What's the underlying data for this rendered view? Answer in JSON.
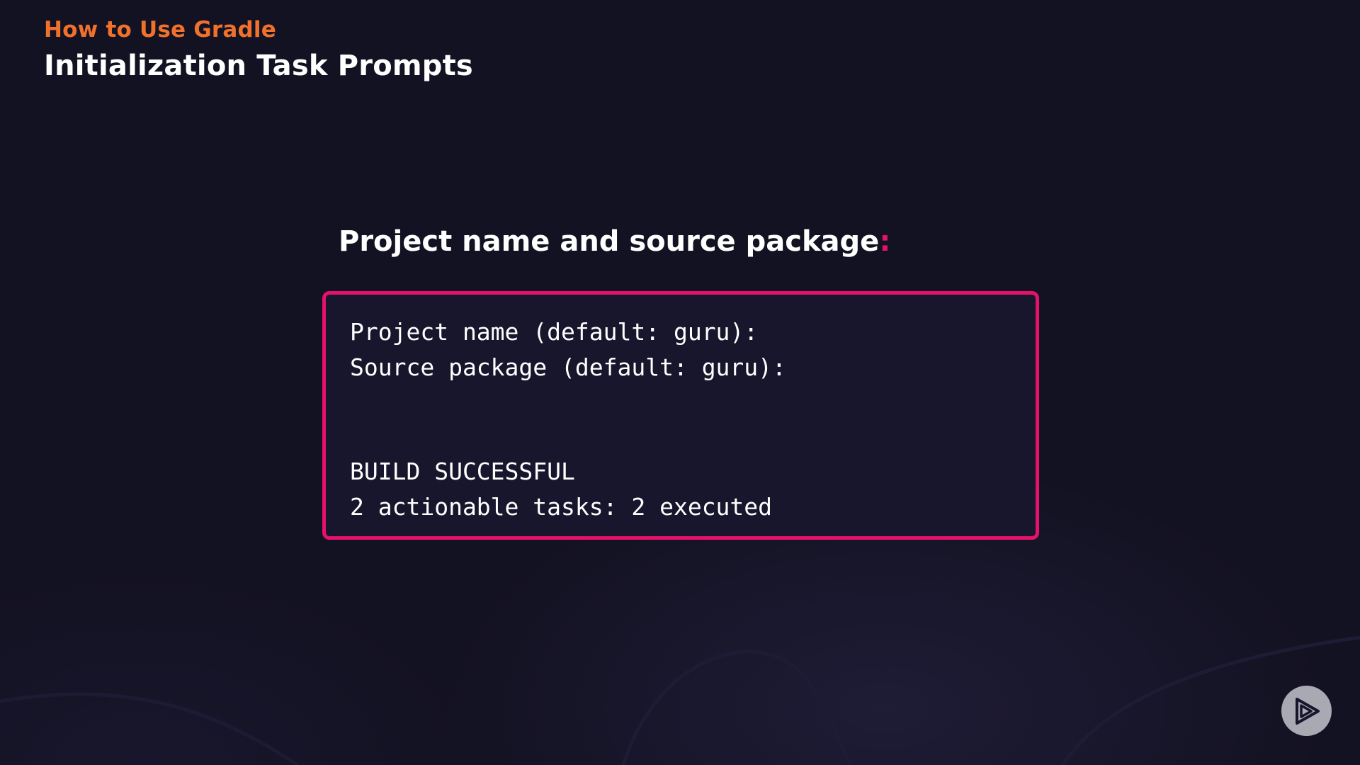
{
  "header": {
    "course_title": "How to Use Gradle",
    "slide_title": "Initialization Task Prompts"
  },
  "section": {
    "heading": "Project name and source package",
    "heading_accent": ":"
  },
  "terminal": {
    "prompt_lines": [
      "Project name (default: guru):",
      "Source package (default: guru):"
    ],
    "result_lines": [
      "BUILD SUCCESSFUL",
      "2 actionable tasks: 2 executed"
    ]
  },
  "colors": {
    "course_title": "#f0712c",
    "accent": "#e5116c",
    "background": "#131222",
    "terminal_background": "#17162c"
  },
  "icons": {
    "brand": "play-icon"
  }
}
